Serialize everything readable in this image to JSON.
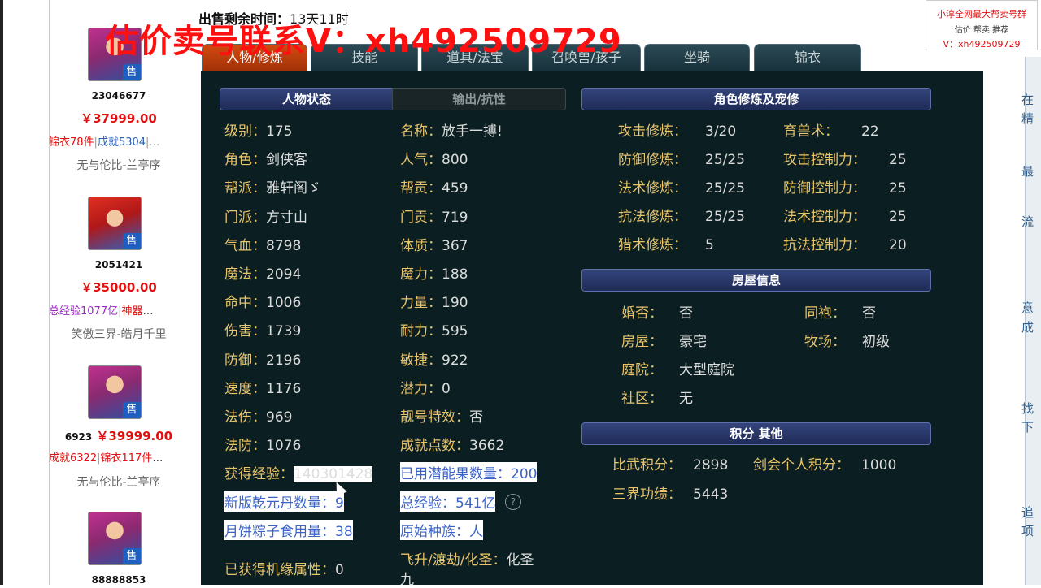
{
  "watermark": "估价卖号联系V：xh492509729",
  "countdown": {
    "label": "出售剩余时间：",
    "value": "13天11时"
  },
  "tabs": [
    "人物/修炼",
    "技能",
    "道具/法宝",
    "召唤兽/孩子",
    "坐骑",
    "锦衣"
  ],
  "ad": {
    "line1": "小淳全网最大帮卖号群",
    "line2": "估价 帮卖 推荐",
    "line3": "V：xh492509729"
  },
  "listings": [
    {
      "id": "23046677",
      "price": "￥37999.00",
      "tag1": "锦衣78件",
      "tag2": "成就5304",
      "server": "无与伦比-兰亭序"
    },
    {
      "id": "2051421",
      "price": "￥35000.00",
      "tag1": "总经验1077亿",
      "tag2": "神器",
      "server": "笑傲三界-皓月千里"
    },
    {
      "id": "6923",
      "price": "￥39999.00",
      "tag1": "成就6322",
      "tag2": "锦衣117件",
      "server": "无与伦比-兰亭序"
    },
    {
      "id": "88888853"
    }
  ],
  "sections": {
    "status": "人物状态",
    "output": "输出/抗性",
    "cultivation": "角色修炼及宠修",
    "house": "房屋信息",
    "score": "积分 其他"
  },
  "stats_left": [
    {
      "k": "级别：",
      "v": "175"
    },
    {
      "k": "角色：",
      "v": "剑侠客"
    },
    {
      "k": "帮派：",
      "v": "雅轩阁ゞ"
    },
    {
      "k": "门派：",
      "v": "方寸山"
    },
    {
      "k": "气血：",
      "v": "8798"
    },
    {
      "k": "魔法：",
      "v": "2094"
    },
    {
      "k": "命中：",
      "v": "1006"
    },
    {
      "k": "伤害：",
      "v": "1739"
    },
    {
      "k": "防御：",
      "v": "2196"
    },
    {
      "k": "速度：",
      "v": "1176"
    },
    {
      "k": "法伤：",
      "v": "969"
    },
    {
      "k": "法防：",
      "v": "1076"
    },
    {
      "k": "获得经验：",
      "v": "140301428"
    },
    {
      "k": "新版乾元丹数量：",
      "v": "9"
    },
    {
      "k": "月饼粽子食用量：",
      "v": "38"
    },
    {
      "k": "已获得机缘属性：",
      "v": "0"
    }
  ],
  "stats_mid": [
    {
      "k": "名称：",
      "v": "放手一搏!"
    },
    {
      "k": "人气：",
      "v": "800"
    },
    {
      "k": "帮贡：",
      "v": "459"
    },
    {
      "k": "门贡：",
      "v": "719"
    },
    {
      "k": "体质：",
      "v": "367"
    },
    {
      "k": "魔力：",
      "v": "188"
    },
    {
      "k": "力量：",
      "v": "190"
    },
    {
      "k": "耐力：",
      "v": "595"
    },
    {
      "k": "敏捷：",
      "v": "922"
    },
    {
      "k": "潜力：",
      "v": "0"
    },
    {
      "k": "靓号特效：",
      "v": "否"
    },
    {
      "k": "成就点数：",
      "v": "3662"
    },
    {
      "k": "已用潜能果数量：",
      "v": "200"
    },
    {
      "k": "总经验：",
      "v": "541亿"
    },
    {
      "k": "原始种族：",
      "v": "人"
    },
    {
      "k": "飞升/渡劫/化圣：",
      "v": "化圣"
    },
    {
      "k": "",
      "v": "九"
    }
  ],
  "cultivation_a": [
    {
      "k": "攻击修炼：",
      "v": "3/20"
    },
    {
      "k": "防御修炼：",
      "v": "25/25"
    },
    {
      "k": "法术修炼：",
      "v": "25/25"
    },
    {
      "k": "抗法修炼：",
      "v": "25/25"
    },
    {
      "k": "猎术修炼：",
      "v": "5"
    }
  ],
  "cultivation_b": [
    {
      "k": "育兽术：",
      "v": "22"
    },
    {
      "k": "攻击控制力：",
      "v": "25"
    },
    {
      "k": "防御控制力：",
      "v": "25"
    },
    {
      "k": "法术控制力：",
      "v": "25"
    },
    {
      "k": "抗法控制力：",
      "v": "20"
    }
  ],
  "house_a": [
    {
      "k": "婚否：",
      "v": "否"
    },
    {
      "k": "房屋：",
      "v": "豪宅"
    },
    {
      "k": "庭院：",
      "v": "大型庭院"
    },
    {
      "k": "社区：",
      "v": "无"
    }
  ],
  "house_b": [
    {
      "k": "同袍：",
      "v": "否"
    },
    {
      "k": "牧场：",
      "v": "初级"
    }
  ],
  "score": [
    {
      "k": "比武积分：",
      "v": "2898"
    },
    {
      "k": "剑会个人积分：",
      "v": "1000"
    },
    {
      "k": "三界功绩：",
      "v": "5443"
    }
  ],
  "sidebar_fragments": [
    "在",
    "精",
    "最",
    "流",
    "意",
    "成",
    "找",
    "下",
    "追",
    "项"
  ],
  "colors": {
    "panel_bg": "#0b1f22",
    "label": "#e9c46a",
    "value": "#dcdcdc",
    "price": "#e01010",
    "active_tab": "#c8400c"
  }
}
